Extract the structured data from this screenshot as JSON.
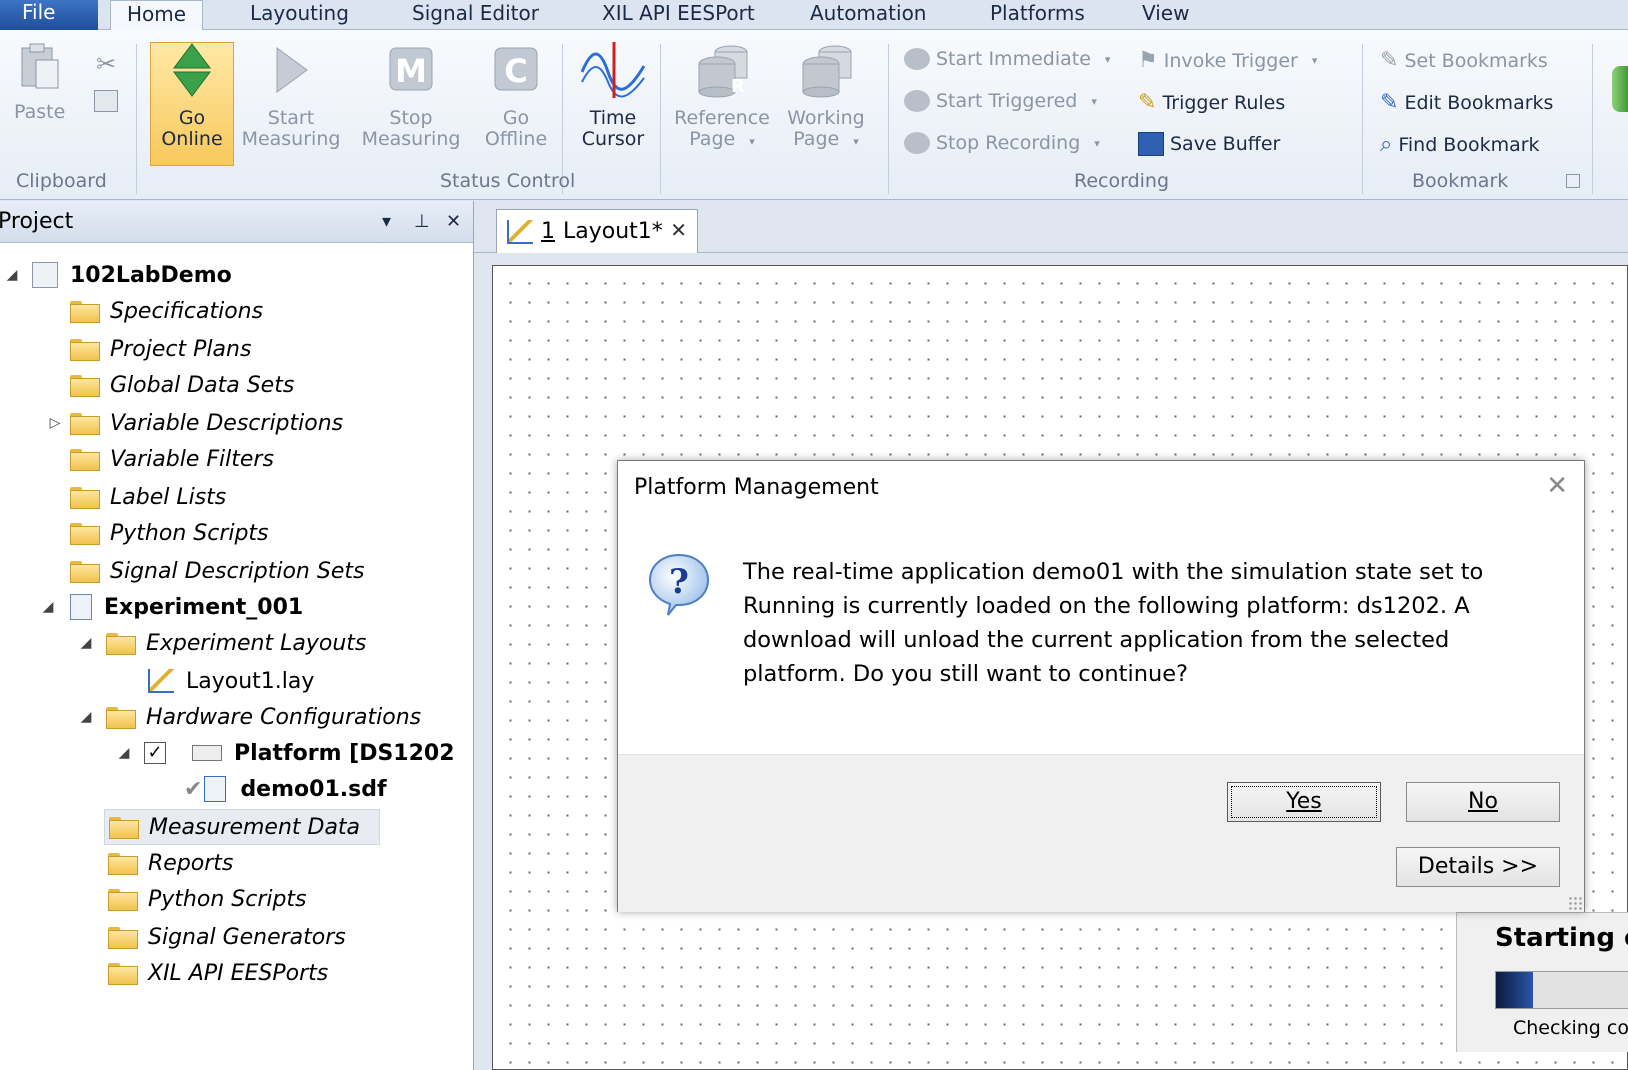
{
  "ribbon_tabs": {
    "file": "File",
    "tabs": [
      "Home",
      "Layouting",
      "Signal Editor",
      "XIL API EESPort",
      "Automation",
      "Platforms",
      "View"
    ]
  },
  "clipboard": {
    "paste": "Paste",
    "group": "Clipboard"
  },
  "status_control": {
    "go_online": [
      "Go",
      "Online"
    ],
    "start_measuring": [
      "Start",
      "Measuring"
    ],
    "stop_measuring": [
      "Stop",
      "Measuring"
    ],
    "go_offline": [
      "Go",
      "Offline"
    ],
    "time_cursor": [
      "Time",
      "Cursor"
    ],
    "reference_page": [
      "Reference",
      "Page"
    ],
    "working_page": [
      "Working",
      "Page"
    ],
    "group": "Status Control"
  },
  "recording": {
    "start_immediate": "Start Immediate",
    "start_triggered": "Start Triggered",
    "stop_recording": "Stop Recording",
    "invoke_trigger": "Invoke Trigger",
    "trigger_rules": "Trigger Rules",
    "save_buffer": "Save Buffer",
    "group": "Recording"
  },
  "bookmark": {
    "set": "Set Bookmarks",
    "edit": "Edit Bookmarks",
    "find": "Find Bookmark",
    "group": "Bookmark"
  },
  "project_panel": {
    "title": "Project",
    "tree": [
      {
        "label": "102LabDemo"
      },
      {
        "label": "Specifications"
      },
      {
        "label": "Project Plans"
      },
      {
        "label": "Global Data Sets"
      },
      {
        "label": "Variable Descriptions"
      },
      {
        "label": "Variable Filters"
      },
      {
        "label": "Label Lists"
      },
      {
        "label": "Python Scripts"
      },
      {
        "label": "Signal Description Sets"
      },
      {
        "label": "Experiment_001"
      },
      {
        "label": "Experiment Layouts"
      },
      {
        "label": "Layout1.lay"
      },
      {
        "label": "Hardware Configurations"
      },
      {
        "label": "Platform [DS1202"
      },
      {
        "label": "demo01.sdf"
      },
      {
        "label": "Measurement Data"
      },
      {
        "label": "Reports"
      },
      {
        "label": "Python Scripts"
      },
      {
        "label": "Signal Generators"
      },
      {
        "label": "XIL API EESPorts"
      }
    ]
  },
  "document": {
    "tab_number": "1",
    "tab_label": "Layout1*"
  },
  "dialog": {
    "title": "Platform Management",
    "message": "The real-time application demo01 with the simulation state set to Running is currently loaded on the following platform: ds1202. A download will unload the current application from the selected platform. Do you still want to continue?",
    "yes": "Yes",
    "no": "No",
    "details": "Details >>"
  },
  "progress": {
    "title": "Starting o",
    "status": "Checking co",
    "fraction": 0.28
  },
  "colors": {
    "accent": "#1f4f9c",
    "go_online_highlight": "#f7c85c"
  }
}
